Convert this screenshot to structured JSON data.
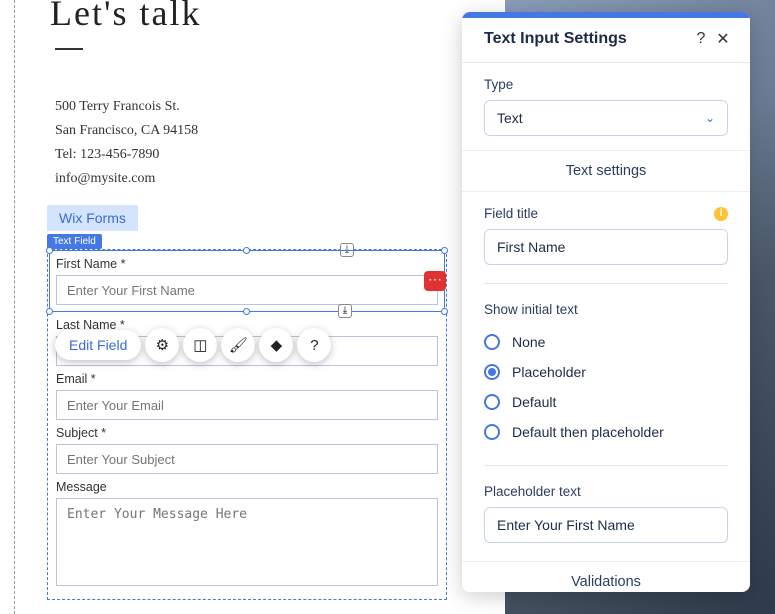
{
  "heading": "Let's talk",
  "contact": {
    "address1": "500 Terry Francois St.",
    "address2": "San Francisco, CA 94158",
    "tel": "Tel: 123-456-7890",
    "email": "info@mysite.com"
  },
  "form": {
    "wix_forms_tab": "Wix Forms",
    "text_field_tag": "Text Field",
    "first_name_label": "First Name *",
    "first_name_placeholder": "Enter Your First Name",
    "last_name_label": "Last Name *",
    "email_label": "Email *",
    "email_placeholder": "Enter Your Email",
    "subject_label": "Subject *",
    "subject_placeholder": "Enter Your Subject",
    "message_label": "Message",
    "message_placeholder": "Enter Your Message Here"
  },
  "toolbar": {
    "edit_field": "Edit Field"
  },
  "panel": {
    "title": "Text Input Settings",
    "type_label": "Type",
    "type_value": "Text",
    "text_settings": "Text settings",
    "field_title_label": "Field title",
    "field_title_value": "First Name",
    "show_initial_label": "Show initial text",
    "radio_none": "None",
    "radio_placeholder": "Placeholder",
    "radio_default": "Default",
    "radio_default_then": "Default then placeholder",
    "selected_initial": "Placeholder",
    "placeholder_text_label": "Placeholder text",
    "placeholder_text_value": "Enter Your First Name",
    "validations": "Validations"
  }
}
